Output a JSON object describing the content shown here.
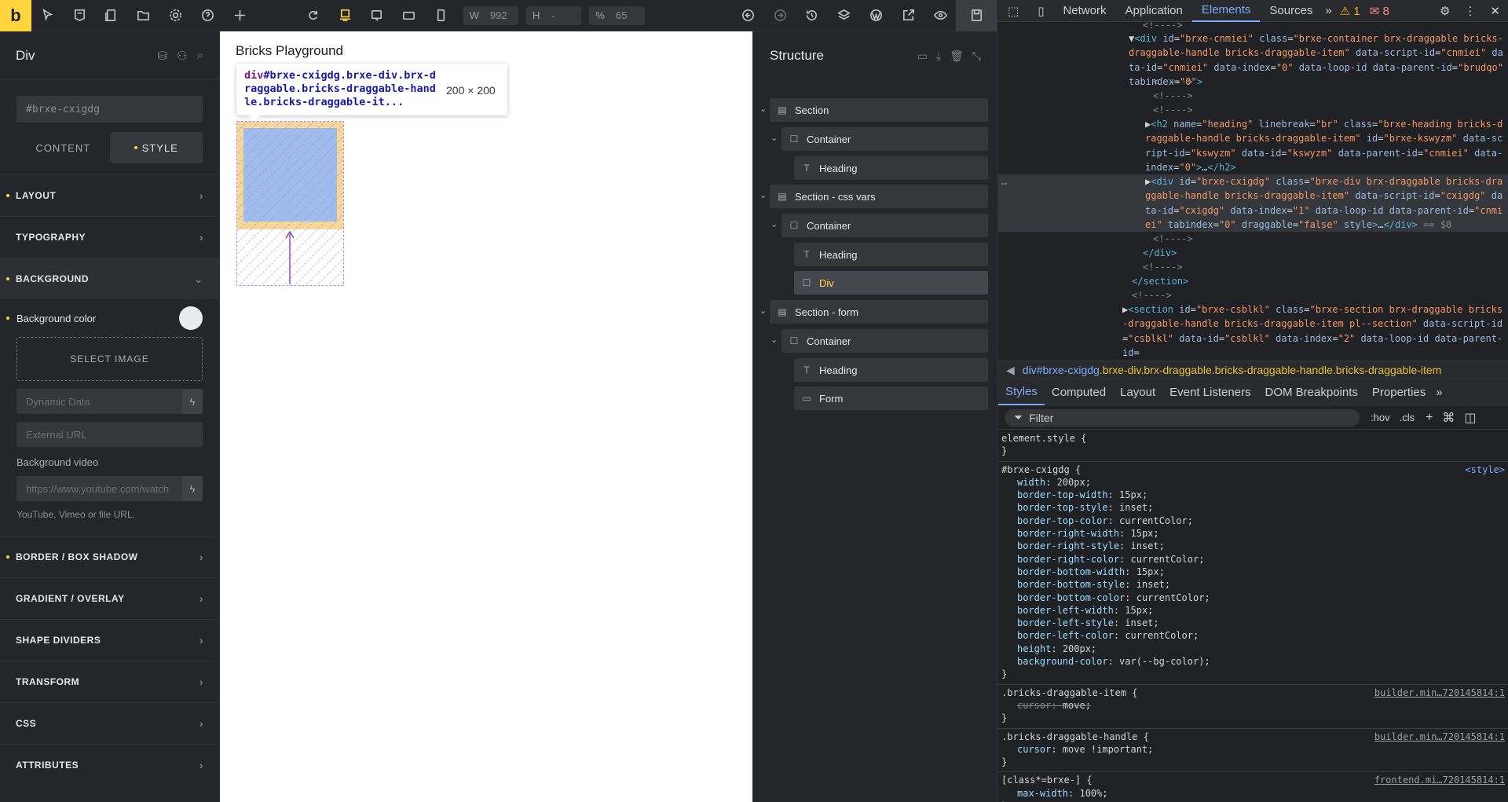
{
  "topbar": {
    "logo": "b",
    "width_label": "W",
    "width_value": "992",
    "height_label": "H",
    "height_value": "-",
    "zoom_label": "%",
    "zoom_value": "65"
  },
  "left_panel": {
    "title": "Div",
    "id_value": "#brxe-cxigdg",
    "tabs": [
      "CONTENT",
      "STYLE"
    ],
    "sections": [
      "LAYOUT",
      "TYPOGRAPHY",
      "BACKGROUND",
      "BORDER / BOX SHADOW",
      "GRADIENT / OVERLAY",
      "SHAPE DIVIDERS",
      "TRANSFORM",
      "CSS",
      "ATTRIBUTES"
    ],
    "background": {
      "color_label": "Background color",
      "select_image": "SELECT IMAGE",
      "dynamic_data_placeholder": "Dynamic Data",
      "external_url_placeholder": "External URL",
      "video_label": "Background video",
      "video_placeholder": "https://www.youtube.com/watch",
      "video_hint": "YouTube, Vimeo or file URL."
    }
  },
  "canvas": {
    "title": "Bricks Playground",
    "tooltip_tag": "div",
    "tooltip_selector": "#brxe-cxigdg.brxe-div.brx-draggable.bricks-draggable-handle.bricks-draggable-it...",
    "tooltip_size": "200 × 200"
  },
  "structure": {
    "title": "Structure",
    "nodes": [
      {
        "label": "Section"
      },
      {
        "label": "Container"
      },
      {
        "label": "Heading"
      },
      {
        "label": "Section - css vars"
      },
      {
        "label": "Container"
      },
      {
        "label": "Heading"
      },
      {
        "label": "Div"
      },
      {
        "label": "Section - form"
      },
      {
        "label": "Container"
      },
      {
        "label": "Heading"
      },
      {
        "label": "Form"
      }
    ]
  },
  "devtools": {
    "tabs": [
      "Network",
      "Application",
      "Elements",
      "Sources"
    ],
    "warnings": "1",
    "errors": "8",
    "breadcrumb_tag": "div",
    "breadcrumb_id": "#brxe-cxigdg",
    "breadcrumb_classes": ".brxe-div.brx-draggable.bricks-draggable-handle.bricks-draggable-item",
    "styles_tabs": [
      "Styles",
      "Computed",
      "Layout",
      "Event Listeners",
      "DOM Breakpoints",
      "Properties"
    ],
    "filter_placeholder": "Filter",
    "hov": ":hov",
    "cls": ".cls",
    "rules": [
      {
        "selector": "element.style {",
        "source": "",
        "props": []
      },
      {
        "selector": "#brxe-cxigdg {",
        "source": "<style>",
        "props": [
          [
            "width",
            "200px;"
          ],
          [
            "border-top-width",
            "15px;"
          ],
          [
            "border-top-style",
            "inset;"
          ],
          [
            "border-top-color",
            "currentColor;"
          ],
          [
            "border-right-width",
            "15px;"
          ],
          [
            "border-right-style",
            "inset;"
          ],
          [
            "border-right-color",
            "currentColor;"
          ],
          [
            "border-bottom-width",
            "15px;"
          ],
          [
            "border-bottom-style",
            "inset;"
          ],
          [
            "border-bottom-color",
            "currentColor;"
          ],
          [
            "border-left-width",
            "15px;"
          ],
          [
            "border-left-style",
            "inset;"
          ],
          [
            "border-left-color",
            "currentColor;"
          ],
          [
            "height",
            "200px;"
          ],
          [
            "background-color",
            "var(--bg-color);"
          ]
        ]
      },
      {
        "selector": ".bricks-draggable-item {",
        "source": "builder.min…720145814:1",
        "props": [
          [
            "cursor",
            "move;"
          ]
        ]
      },
      {
        "selector": ".bricks-draggable-handle {",
        "source": "builder.min…720145814:1",
        "props": [
          [
            "cursor",
            "move !important;"
          ]
        ]
      },
      {
        "selector": "[class*=brxe-] {",
        "source": "frontend.mi…720145814:1",
        "props": [
          [
            "max-width",
            "100%;"
          ]
        ]
      }
    ]
  }
}
